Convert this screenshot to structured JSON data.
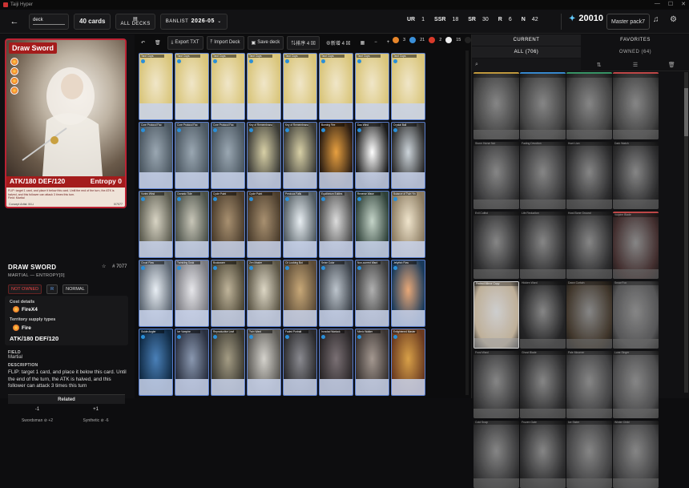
{
  "window": {
    "title": "Taiji Hyper",
    "controls": [
      "—",
      "☐",
      "✕"
    ]
  },
  "topbar": {
    "deck_label": "deck",
    "cards": "40 cards",
    "all_decks": "ALL DECKS",
    "banlist_label": "BANLIST",
    "banlist_value": "2026-05",
    "rarities": [
      {
        "k": "UR",
        "v": "1"
      },
      {
        "k": "SSR",
        "v": "18"
      },
      {
        "k": "SR",
        "v": "30"
      },
      {
        "k": "R",
        "v": "6"
      },
      {
        "k": "N",
        "v": "42"
      }
    ],
    "points": "20010",
    "pack": "Master pack7"
  },
  "left": {
    "card_name": "Draw Sword",
    "stats": "ATK/180 DEF/120",
    "entropy": "Entropy 0",
    "card_text": "FLIP: target 1 card, and place it below this card. Until the end of the turn, the ATK is halved, and this follower can attack 3 times this turn.",
    "card_field": "Field: Martial",
    "artist": "Concept Artist: M.Li",
    "card_no": "0/7077",
    "title": "DRAW SWORD",
    "subtitle": "MARTIAL — ENTROPY[0]",
    "number": "# 7077",
    "not_owned": "NOT OWNED",
    "rarity_badge": "R",
    "normal": "NORMAL",
    "cost_label": "Cost details",
    "cost_value": "FireX4",
    "territory_label": "Territory supply types",
    "territory_value": "Fire",
    "atk_def": "ATK/180 DEF/120",
    "field_label": "FIELD",
    "field_value": "Martial",
    "desc_label": "DESCRIPTION",
    "description": "FLIP: target 1 card, and place it below this card. Until the end of the turn, the ATK is halved, and this follower can attack 3 times this turn",
    "related": "Related",
    "minus": "-1",
    "plus": "+1",
    "deselect": "Swordsman ⊘ +2",
    "synthetic": "Synthetic ⊘ -6"
  },
  "toolbar": {
    "export": "Export TXT",
    "import": "Import Deck",
    "save": "Save deck",
    "sort": "⇅排序 4 ⊠",
    "filter": "⊕新增 4 ⊠",
    "elements": [
      {
        "color": "#e8862a",
        "n": "3"
      },
      {
        "color": "#3a8fd8",
        "n": "21"
      },
      {
        "color": "#d83a2a",
        "n": "2"
      },
      {
        "color": "#eeeeee",
        "n": "15"
      },
      {
        "color": "#222222",
        "n": "1"
      }
    ]
  },
  "deck_cards": [
    {
      "n": "Tarot Cups",
      "c": "#d9c57a",
      "c2": "#f0e6c8"
    },
    {
      "n": "Tarot Cups",
      "c": "#d9c57a",
      "c2": "#f0e6c8"
    },
    {
      "n": "Tarot Cups",
      "c": "#d9c57a",
      "c2": "#f0e6c8"
    },
    {
      "n": "Tarot Cups",
      "c": "#d9c57a",
      "c2": "#f0e6c8"
    },
    {
      "n": "Tarot Cups",
      "c": "#d9c57a",
      "c2": "#f0e6c8"
    },
    {
      "n": "Tarot Cups",
      "c": "#d9c57a",
      "c2": "#f0e6c8"
    },
    {
      "n": "Tarot Cups",
      "c": "#d9c57a",
      "c2": "#f0e6c8"
    },
    {
      "n": "Tarot Cups",
      "c": "#d9c57a",
      "c2": "#f0e6c8"
    },
    {
      "n": "Core Protocol Fac",
      "c": "#4a5660",
      "c2": "#9aa7b2"
    },
    {
      "n": "Core Protocol Fac",
      "c": "#4a5660",
      "c2": "#9aa7b2"
    },
    {
      "n": "Core Protocol Fac",
      "c": "#4a5660",
      "c2": "#9aa7b2"
    },
    {
      "n": "Key of Remembrance",
      "c": "#3a3a36",
      "c2": "#d8d0a6"
    },
    {
      "n": "Key of Remembrance",
      "c": "#3a3a36",
      "c2": "#d8d0a6"
    },
    {
      "n": "Burning Fire",
      "c": "#2a1c12",
      "c2": "#e8a040"
    },
    {
      "n": "Dao Wind",
      "c": "#1a1a1a",
      "c2": "#ffffff"
    },
    {
      "n": "Crystal Ball",
      "c": "#2a2a2a",
      "c2": "#ccd4da"
    },
    {
      "n": "Vortex Wind",
      "c": "#5a5a4e",
      "c2": "#d8d4c4"
    },
    {
      "n": "Oceanic Tide",
      "c": "#4a5048",
      "c2": "#c8c6b8"
    },
    {
      "n": "Cycle Point",
      "c": "#4a3c2c",
      "c2": "#a89070"
    },
    {
      "n": "Cycle Point",
      "c": "#4a3c2c",
      "c2": "#a89070"
    },
    {
      "n": "Precious Falls",
      "c": "#505a60",
      "c2": "#e8eef2"
    },
    {
      "n": "Equilibrium Eddies",
      "c": "#4a4a4a",
      "c2": "#dcdcdc"
    },
    {
      "n": "Reverse Wave",
      "c": "#2e4038",
      "c2": "#c4d4c8"
    },
    {
      "n": "Balance of Twin Yin",
      "c": "#8a7a60",
      "c2": "#efe4cc"
    },
    {
      "n": "Cloud Flow",
      "c": "#5a6470",
      "c2": "#e8eef4"
    },
    {
      "n": "Twinkling Dusk",
      "c": "#7a7a80",
      "c2": "#e6e6ea"
    },
    {
      "n": "Bookworm",
      "c": "#4a4434",
      "c2": "#bfb49a"
    },
    {
      "n": "Zen Master",
      "c": "#5a5444",
      "c2": "#dcd6c4"
    },
    {
      "n": "Cit Looking Bot",
      "c": "#5a4a36",
      "c2": "#c8a878"
    },
    {
      "n": "Seize Color",
      "c": "#3a4048",
      "c2": "#bcc4cc"
    },
    {
      "n": "Non-current Ward",
      "c": "#3a3a3a",
      "c2": "#b0b0b0"
    },
    {
      "n": "Jellyfish Flow",
      "c": "#1a3a5a",
      "c2": "#e8a878"
    },
    {
      "n": "Guide Angler",
      "c": "#102a44",
      "c2": "#4a80b8"
    },
    {
      "n": "Ice Vampire",
      "c": "#2a3040",
      "c2": "#8a98b0"
    },
    {
      "n": "Reproductive Leaf",
      "c": "#3a3830",
      "c2": "#a49c84"
    },
    {
      "n": "Twin Ward",
      "c": "#5a5854",
      "c2": "#d4d2cc"
    },
    {
      "n": "Faded Portrait",
      "c": "#2a2a2c",
      "c2": "#8a8a90"
    },
    {
      "n": "Ironclad Warlock",
      "c": "#2a2628",
      "c2": "#7a7074"
    },
    {
      "n": "Mimic Walker",
      "c": "#3a3432",
      "c2": "#a49890"
    },
    {
      "n": "Enlightened Master",
      "c": "#6a3a20",
      "c2": "#d8a048"
    }
  ],
  "right": {
    "tab_current": "CURRENT",
    "tab_favorites": "FAVORITES",
    "tab_all": "ALL (706)",
    "tab_owned": "OWNED (64)",
    "cards": [
      {
        "n": "",
        "c": "#6a6a6a",
        "h": "#c9a040"
      },
      {
        "n": "",
        "c": "#6a6a6a",
        "h": "#3a8fd8"
      },
      {
        "n": "",
        "c": "#6a6a6a",
        "h": "#3a9a6a"
      },
      {
        "n": "",
        "c": "#6a6a6a",
        "h": "#c84a4a"
      },
      {
        "n": "Storm Horse Nut",
        "c": "#5a5a5c",
        "h": ""
      },
      {
        "n": "Fading Devotion",
        "c": "#5a5a5c",
        "h": ""
      },
      {
        "n": "Hunt Lion",
        "c": "#4a4a4c",
        "h": ""
      },
      {
        "n": "Dark Watch",
        "c": "#4a4a4c",
        "h": ""
      },
      {
        "n": "Evil Cultist",
        "c": "#4a4a4c",
        "h": ""
      },
      {
        "n": "Life Reduction",
        "c": "#4a4a4c",
        "h": ""
      },
      {
        "n": "Howl Bone Ground",
        "c": "#4a4a4c",
        "h": ""
      },
      {
        "n": "Vulpine Blade",
        "c": "#6a4a4a",
        "h": "#c84a4a"
      },
      {
        "n": "Perfect Mirror Copy",
        "c": "#c8b8a0",
        "h": ""
      },
      {
        "n": "Hidden Ward",
        "c": "#3a3a3c",
        "h": ""
      },
      {
        "n": "Dawn Curtain",
        "c": "#6a5a48",
        "h": ""
      },
      {
        "n": "Snow Fox",
        "c": "#8a8a8c",
        "h": ""
      },
      {
        "n": "Frost Ward",
        "c": "#5a5a5c",
        "h": ""
      },
      {
        "n": "Ghost Blade",
        "c": "#4a4a4c",
        "h": ""
      },
      {
        "n": "Pale Mourner",
        "c": "#6a6a6c",
        "h": ""
      },
      {
        "n": "Lone Singer",
        "c": "#7a7a7c",
        "h": ""
      },
      {
        "n": "Cold Snap",
        "c": "#5a5a5c",
        "h": ""
      },
      {
        "n": "Frozen Gate",
        "c": "#4a4a4c",
        "h": ""
      },
      {
        "n": "Ice Sister",
        "c": "#6a6a6c",
        "h": ""
      },
      {
        "n": "Winter Child",
        "c": "#6a6a6c",
        "h": ""
      }
    ]
  }
}
